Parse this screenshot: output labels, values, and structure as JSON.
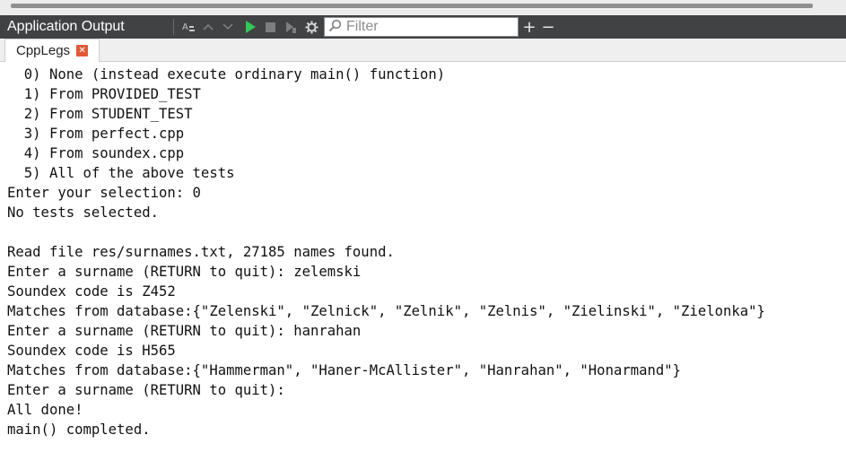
{
  "toolbar": {
    "title": "Application Output",
    "icons": [
      "text-format-icon",
      "chevron-up-icon",
      "chevron-down-icon",
      "run-icon",
      "stop-icon",
      "attach-debugger-icon",
      "settings-gear-icon"
    ],
    "filter_placeholder": "Filter",
    "add_label": "+",
    "minimize_label": "−"
  },
  "tab": {
    "label": "CppLegs",
    "close_glyph": "✕"
  },
  "output": {
    "lines": [
      "  0) None (instead execute ordinary main() function)",
      "  1) From PROVIDED_TEST",
      "  2) From STUDENT_TEST",
      "  3) From perfect.cpp",
      "  4) From soundex.cpp",
      "  5) All of the above tests",
      "Enter your selection: 0",
      "No tests selected.",
      "",
      "Read file res/surnames.txt, 27185 names found.",
      "Enter a surname (RETURN to quit): zelemski",
      "Soundex code is Z452",
      "Matches from database:{\"Zelenski\", \"Zelnick\", \"Zelnik\", \"Zelnis\", \"Zielinski\", \"Zielonka\"}",
      "Enter a surname (RETURN to quit): hanrahan",
      "Soundex code is H565",
      "Matches from database:{\"Hammerman\", \"Haner-McAllister\", \"Hanrahan\", \"Honarmand\"}",
      "Enter a surname (RETURN to quit):",
      "All done!",
      "main() completed."
    ]
  },
  "colors": {
    "toolbar_bg": "#404244",
    "run_green": "#34c759",
    "close_red": "#e05a3a"
  }
}
